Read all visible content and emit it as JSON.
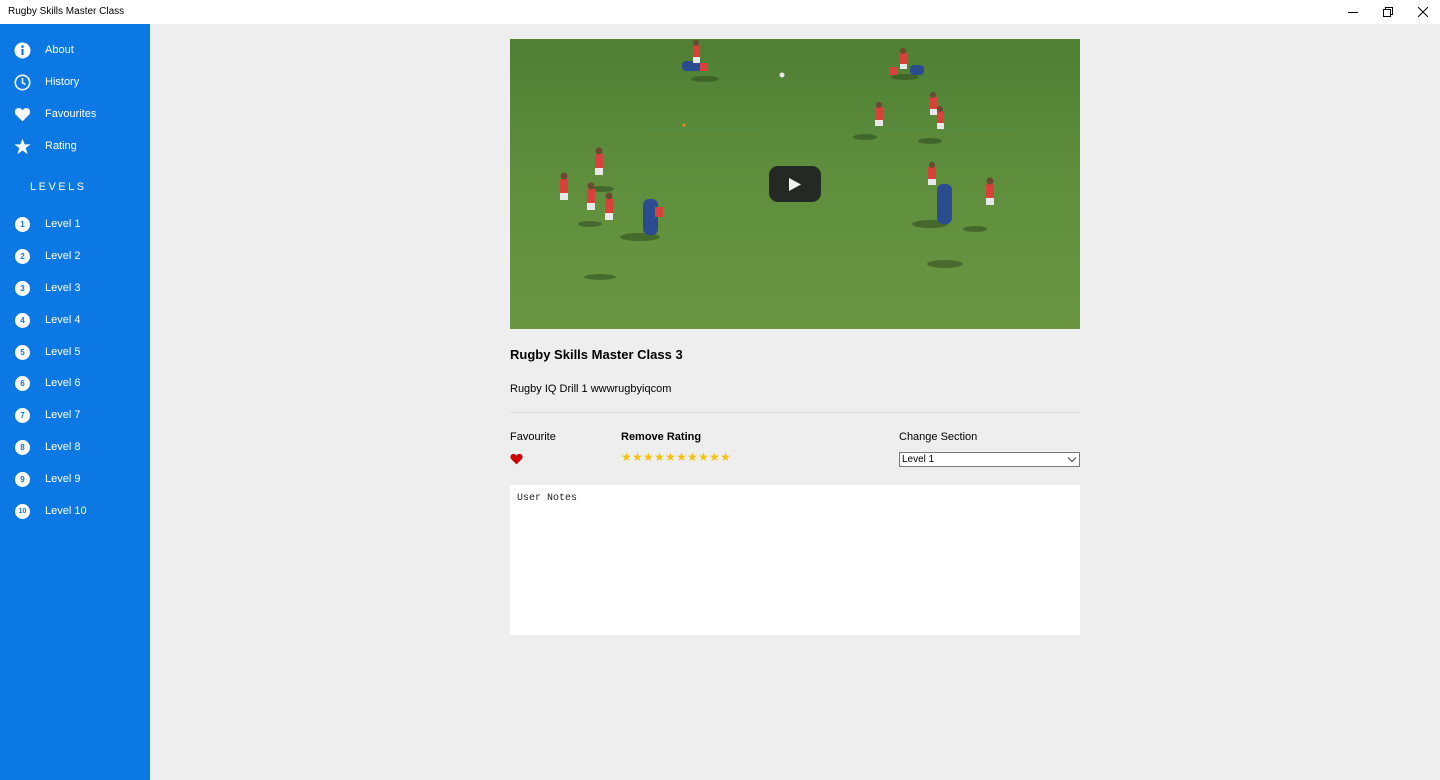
{
  "window": {
    "title": "Rugby Skills Master Class"
  },
  "sidebar": {
    "menu": [
      {
        "label": "About",
        "icon": "info-icon"
      },
      {
        "label": "History",
        "icon": "clock-icon"
      },
      {
        "label": "Favourites",
        "icon": "heart-icon"
      },
      {
        "label": "Rating",
        "icon": "star-icon"
      }
    ],
    "levels_heading": "LEVELS",
    "levels": [
      {
        "num": "1",
        "label": "Level 1"
      },
      {
        "num": "2",
        "label": "Level 2"
      },
      {
        "num": "3",
        "label": "Level 3"
      },
      {
        "num": "4",
        "label": "Level 4"
      },
      {
        "num": "5",
        "label": "Level 5"
      },
      {
        "num": "6",
        "label": "Level 6"
      },
      {
        "num": "7",
        "label": "Level 7"
      },
      {
        "num": "8",
        "label": "Level 8"
      },
      {
        "num": "9",
        "label": "Level 9"
      },
      {
        "num": "10",
        "label": "Level 10"
      }
    ]
  },
  "video": {
    "title": "Rugby Skills Master Class 3",
    "description": "Rugby IQ Drill 1 wwwrugbyiqcom"
  },
  "details": {
    "favourite_label": "Favourite",
    "rating_label": "Remove Rating",
    "rating_stars": 10,
    "section_label": "Change Section",
    "section_value": "Level 1"
  },
  "notes": {
    "placeholder": "User Notes"
  },
  "colors": {
    "sidebar": "#0b78e3",
    "background": "#eeeeee",
    "heart": "#cc0000",
    "star": "#f4c20d"
  }
}
